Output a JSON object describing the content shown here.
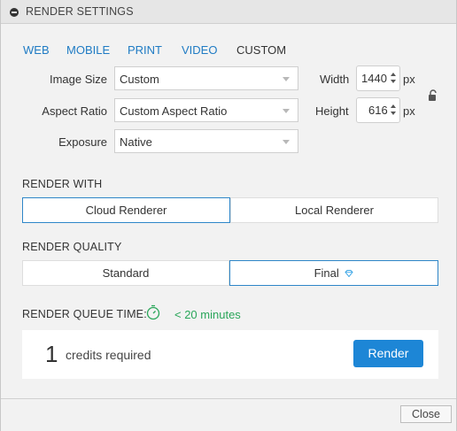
{
  "window": {
    "title": "RENDER SETTINGS"
  },
  "tabs": [
    {
      "label": "WEB"
    },
    {
      "label": "MOBILE"
    },
    {
      "label": "PRINT"
    },
    {
      "label": "VIDEO"
    },
    {
      "label": "CUSTOM",
      "active": true
    }
  ],
  "fields": {
    "image_size": {
      "label": "Image Size",
      "value": "Custom"
    },
    "aspect_ratio": {
      "label": "Aspect Ratio",
      "value": "Custom Aspect Ratio"
    },
    "exposure": {
      "label": "Exposure",
      "value": "Native"
    }
  },
  "dimensions": {
    "width": {
      "label": "Width",
      "value": "1440",
      "unit": "px"
    },
    "height": {
      "label": "Height",
      "value": "616",
      "unit": "px"
    }
  },
  "render_with": {
    "label": "RENDER WITH",
    "options": [
      "Cloud Renderer",
      "Local Renderer"
    ],
    "selected": "Cloud Renderer"
  },
  "render_quality": {
    "label": "RENDER QUALITY",
    "options": [
      "Standard",
      "Final"
    ],
    "selected": "Final"
  },
  "queue": {
    "label": "RENDER QUEUE TIME:",
    "time": "< 20 minutes"
  },
  "credits": {
    "count": "1",
    "text": "credits required"
  },
  "buttons": {
    "render": "Render",
    "close": "Close"
  },
  "colors": {
    "accent": "#1d86d6",
    "link": "#1f7bc4",
    "success": "#2aa65a"
  },
  "icons": [
    "collapse-icon",
    "caret-down-icon",
    "stepper-icon",
    "unlock-icon",
    "diamond-icon",
    "timer-icon"
  ]
}
